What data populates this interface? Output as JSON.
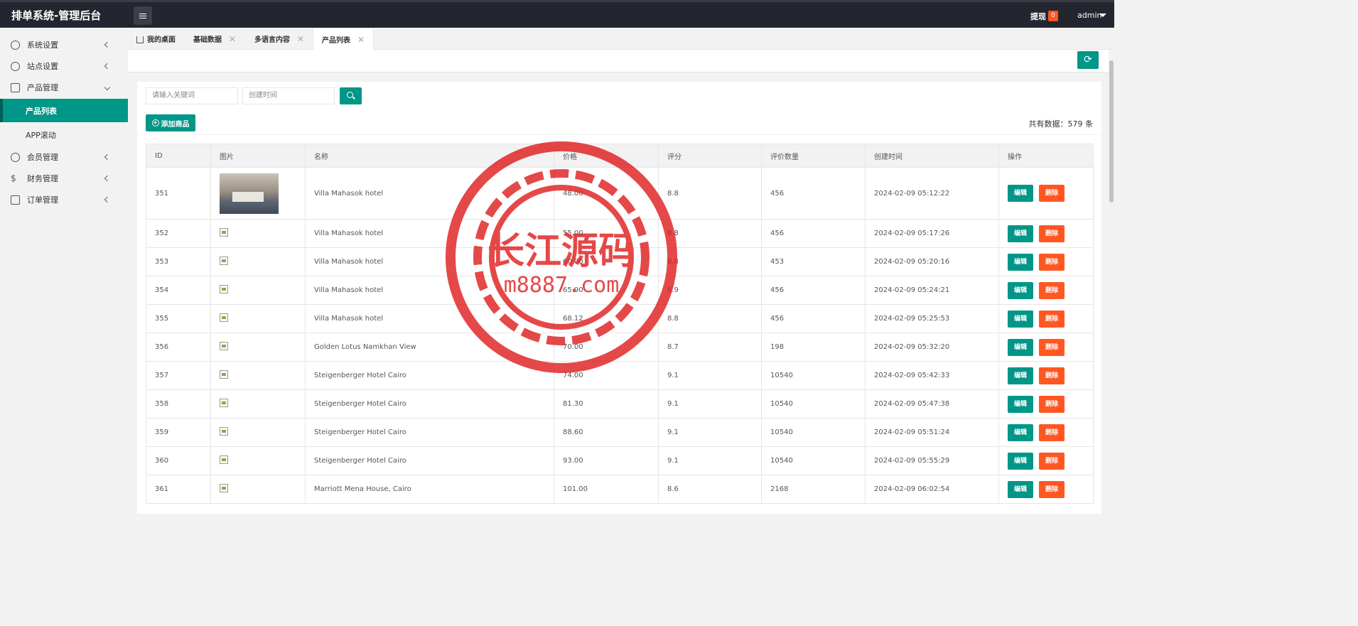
{
  "app": {
    "title": "排单系统-管理后台"
  },
  "header": {
    "withdraw_label": "提现",
    "withdraw_count": "0",
    "user": "admin"
  },
  "sidebar": {
    "items": [
      {
        "label": "系统设置",
        "icon": "gear-icon"
      },
      {
        "label": "站点设置",
        "icon": "cloud-icon"
      },
      {
        "label": "产品管理",
        "icon": "box-icon",
        "expanded": true
      },
      {
        "label": "会员管理",
        "icon": "user-icon"
      },
      {
        "label": "财务管理",
        "icon": "dollar-icon"
      },
      {
        "label": "订单管理",
        "icon": "package-icon"
      }
    ],
    "sub_items": [
      {
        "label": "产品列表",
        "active": true
      },
      {
        "label": "APP滚动",
        "active": false
      }
    ]
  },
  "tabs": [
    {
      "label": "我的桌面",
      "closable": false
    },
    {
      "label": "基础数据",
      "closable": true
    },
    {
      "label": "多语言内容",
      "closable": true
    },
    {
      "label": "产品列表",
      "closable": true,
      "active": true
    }
  ],
  "filters": {
    "keyword_placeholder": "请输入关键词",
    "date_placeholder": "创建时间"
  },
  "toolbar": {
    "add_label": "添加商品",
    "total_text": "共有数据：579 条"
  },
  "table": {
    "columns": [
      "ID",
      "图片",
      "名称",
      "价格",
      "评分",
      "评价数量",
      "创建时间",
      "操作"
    ],
    "edit_label": "编辑",
    "delete_label": "删除",
    "rows": [
      {
        "id": "351",
        "name": "Villa Mahasok hotel",
        "price": "48.00",
        "rating": "8.8",
        "reviews": "456",
        "created": "2024-02-09 05:12:22",
        "image": "photo"
      },
      {
        "id": "352",
        "name": "Villa Mahasok hotel",
        "price": "55.00",
        "rating": "8.8",
        "reviews": "456",
        "created": "2024-02-09 05:17:26",
        "image": "broken"
      },
      {
        "id": "353",
        "name": "Villa Mahasok hotel",
        "price": "60.00",
        "rating": "8.8",
        "reviews": "453",
        "created": "2024-02-09 05:20:16",
        "image": "broken"
      },
      {
        "id": "354",
        "name": "Villa Mahasok hotel",
        "price": "65.90",
        "rating": "8.9",
        "reviews": "456",
        "created": "2024-02-09 05:24:21",
        "image": "broken"
      },
      {
        "id": "355",
        "name": "Villa Mahasok hotel",
        "price": "68.12",
        "rating": "8.8",
        "reviews": "456",
        "created": "2024-02-09 05:25:53",
        "image": "broken"
      },
      {
        "id": "356",
        "name": "Golden Lotus Namkhan View",
        "price": "70.00",
        "rating": "8.7",
        "reviews": "198",
        "created": "2024-02-09 05:32:20",
        "image": "broken"
      },
      {
        "id": "357",
        "name": "Steigenberger Hotel Cairo",
        "price": "74.00",
        "rating": "9.1",
        "reviews": "10540",
        "created": "2024-02-09 05:42:33",
        "image": "broken"
      },
      {
        "id": "358",
        "name": "Steigenberger Hotel Cairo",
        "price": "81.30",
        "rating": "9.1",
        "reviews": "10540",
        "created": "2024-02-09 05:47:38",
        "image": "broken"
      },
      {
        "id": "359",
        "name": "Steigenberger Hotel Cairo",
        "price": "88.60",
        "rating": "9.1",
        "reviews": "10540",
        "created": "2024-02-09 05:51:24",
        "image": "broken"
      },
      {
        "id": "360",
        "name": "Steigenberger Hotel Cairo",
        "price": "93.00",
        "rating": "9.1",
        "reviews": "10540",
        "created": "2024-02-09 05:55:29",
        "image": "broken"
      },
      {
        "id": "361",
        "name": "Marriott Mena House, Cairo",
        "price": "101.00",
        "rating": "8.6",
        "reviews": "2168",
        "created": "2024-02-09 06:02:54",
        "image": "broken"
      }
    ]
  },
  "watermark": {
    "line1": "长江源码",
    "line2": "m8887.com",
    "color": "#e02020"
  },
  "colors": {
    "primary": "#009688",
    "danger": "#ff5722",
    "topbar": "#23262e"
  }
}
